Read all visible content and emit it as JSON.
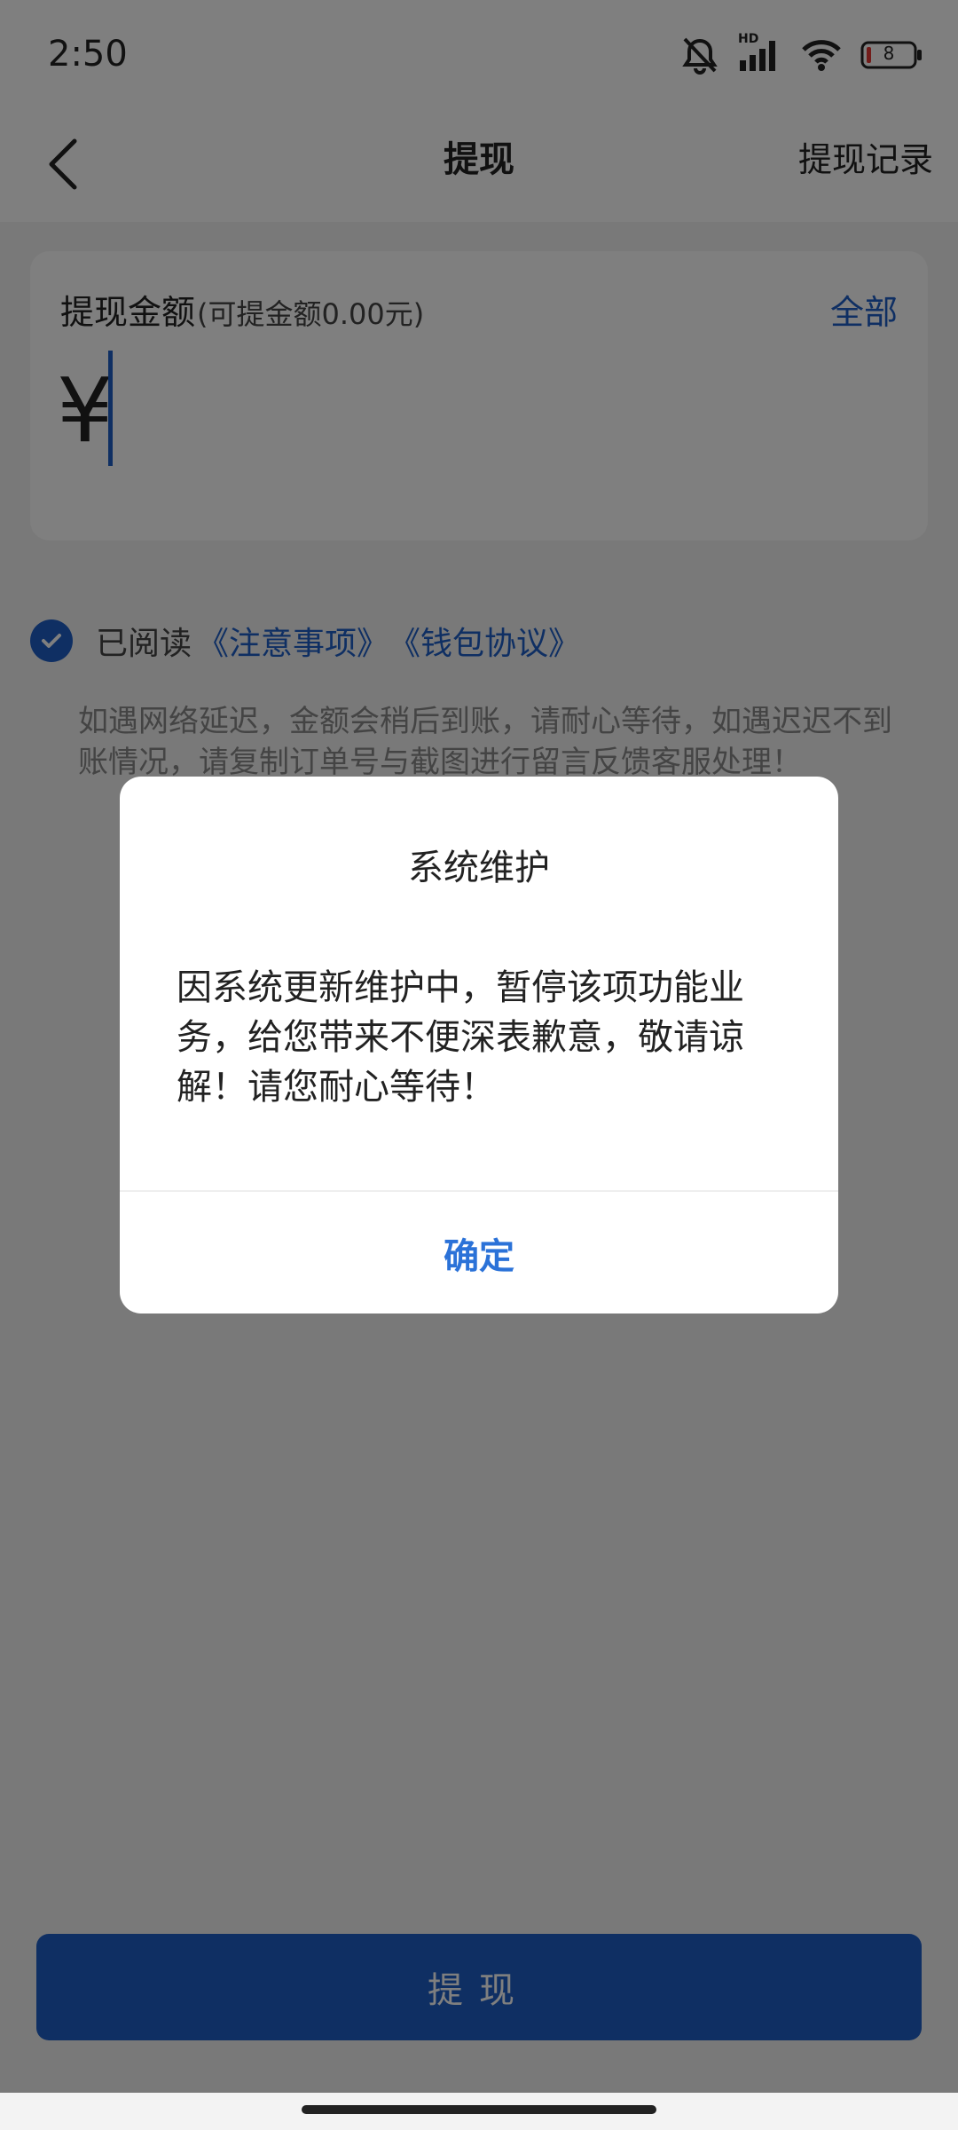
{
  "status": {
    "time": "2:50",
    "battery": "8",
    "hd_label": "HD"
  },
  "nav": {
    "title": "提现",
    "right_label": "提现记录"
  },
  "amount_card": {
    "label": "提现金额",
    "available": "(可提金额0.00元)",
    "all_label": "全部",
    "currency": "¥"
  },
  "agreement": {
    "prefix": "已阅读",
    "link_notice": "《注意事项》",
    "link_wallet": "《钱包协议》"
  },
  "notice": "如遇网络延迟，金额会稍后到账，请耐心等待，如遇迟迟不到账情况，请复制订单号与截图进行留言反馈客服处理！",
  "submit_label": "提现",
  "dialog": {
    "title": "系统维护",
    "message": "因系统更新维护中，暂停该项功能业务，给您带来不便深表歉意，敬请谅解！请您耐心等待！",
    "confirm_label": "确定"
  },
  "colors": {
    "accent": "#1e5fc7",
    "dialog_button": "#2b72d8",
    "battery_low": "#e53935"
  }
}
